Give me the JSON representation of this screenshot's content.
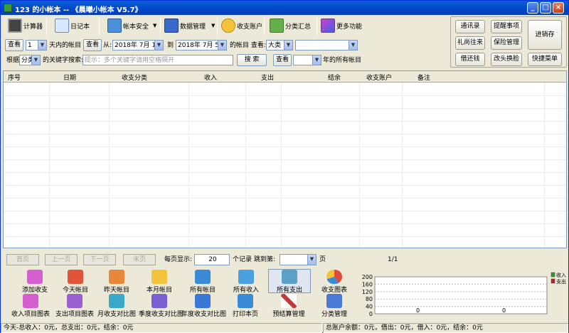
{
  "window": {
    "title": "123 的小帐本 -- 《晨曦小帐本 V5.7》",
    "min": "_",
    "max": "□",
    "close": "×"
  },
  "toolbar": {
    "calculator": "计算器",
    "diary": "日记本",
    "account_security": "帐本安全",
    "data_management": "数据管理",
    "account": "收支账户",
    "category_summary": "分类汇总",
    "more": "更多功能"
  },
  "right_panel": {
    "contacts": "通讯录",
    "reminders": "提醒事项",
    "gifts": "礼尚往来",
    "insurance": "保险管理",
    "loans": "借还钱",
    "redeem": "改头换脸",
    "stock": "进销存",
    "shortcut": "快捷菜单"
  },
  "filter": {
    "view1": "查看",
    "days_value": "1",
    "days_suffix": "天内的帐目",
    "view2": "查看",
    "from_label": "从:",
    "from_date": "2018年 7月 1日",
    "to_label": "到",
    "to_date": "2018年 7月 5日",
    "range_suffix": "的帐目 查看:",
    "category_value": "大类",
    "subcategory_value": "",
    "basis_label": "根据",
    "basis_value": "分类",
    "keyword_label": "的关键字搜索:",
    "keyword_placeholder": "提示：多个关键字请用空格隔开",
    "search": "搜 索",
    "view3": "查看",
    "year_value": "",
    "year_suffix": "年的所有帐目"
  },
  "grid": {
    "columns": [
      "序号",
      "日期",
      "收支分类",
      "收入",
      "支出",
      "结余",
      "收支账户",
      "备注"
    ]
  },
  "pager": {
    "first": "首页",
    "prev": "上一页",
    "next": "下一页",
    "last": "末页",
    "per_page_label": "每页显示:",
    "per_page": "20",
    "records_label": "个记录",
    "jump_label": "跳到第:",
    "jump_value": "",
    "page_label": "页",
    "page_info": "1/1"
  },
  "bottom": {
    "add": "添加收支",
    "today": "今天帐目",
    "yesterday": "昨天帐目",
    "month": "本月帐目",
    "all": "所有帐目",
    "all_income": "所有收入",
    "all_expense": "所有支出",
    "chart": "收支图表",
    "income_chart": "收入项目图表",
    "expense_chart": "支出项目图表",
    "month_compare": "月收支对比图",
    "season_compare": "季度收支对比图",
    "year_compare": "年度收支对比图",
    "print": "打印本页",
    "budget": "预结算管理",
    "category_mgr": "分类管理"
  },
  "chart_data": {
    "type": "bar",
    "categories": [
      "收入",
      "支出"
    ],
    "series": [
      {
        "name": "收入",
        "values": [
          0
        ],
        "color": "#2e9b2e"
      },
      {
        "name": "支出",
        "values": [
          0
        ],
        "color": "#c41e1e"
      }
    ],
    "value_labels": [
      "0",
      "0"
    ],
    "yticks": [
      "200",
      "160",
      "120",
      "80",
      "40",
      "0"
    ],
    "ylim": [
      0,
      200
    ],
    "legend": "top-right"
  },
  "status": {
    "today": "今天-总收入：0元，总支出：0元，结余：0元",
    "accounts": "总账户余额：0元，借出：0元，借入：0元，结余：0元"
  }
}
